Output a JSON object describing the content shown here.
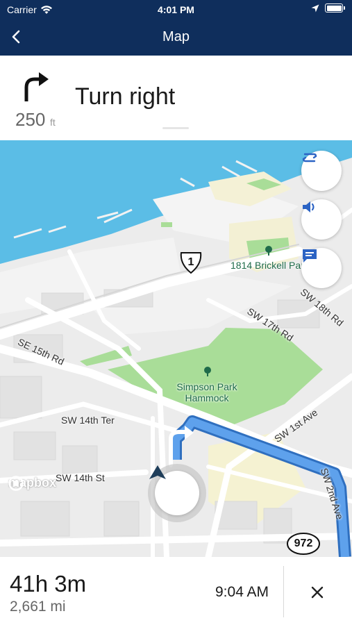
{
  "status_bar": {
    "carrier": "Carrier",
    "time": "4:01 PM",
    "icons": [
      "wifi-icon",
      "location-arrow-icon",
      "battery-icon"
    ]
  },
  "nav": {
    "back_icon": "chevron-left-icon",
    "title": "Map"
  },
  "instruction": {
    "maneuver_icon": "turn-right-arrow-icon",
    "distance_value": "250",
    "distance_unit": "ft",
    "text": "Turn right"
  },
  "map": {
    "labels": {
      "se_15th": "SE 15th Rd",
      "sw_14th_ter": "SW 14th Ter",
      "sw_14th_st": "SW 14th St",
      "sw_17th": "SW 17th Rd",
      "sw_18th": "SW 18th Rd",
      "sw_1st": "SW 1st Ave",
      "sw_2nd": "SW 2nd Ave",
      "park_brickell": "1814 Brickell Par",
      "park_simpson_1": "Simpson Park",
      "park_simpson_2": "Hammock"
    },
    "shields": {
      "us_route": "1",
      "county_route": "972"
    },
    "attribution": "mapbox",
    "buttons": [
      "route-overview-icon",
      "speaker-icon",
      "feedback-icon"
    ],
    "colors": {
      "water": "#5bbde6",
      "park": "#a9dd98",
      "route": "#4a90e2",
      "route_outline": "#2f6fbf"
    }
  },
  "trip": {
    "duration": "41h 3m",
    "distance": "2,661 mi",
    "arrival": "9:04 AM",
    "cancel_icon": "close-icon"
  }
}
